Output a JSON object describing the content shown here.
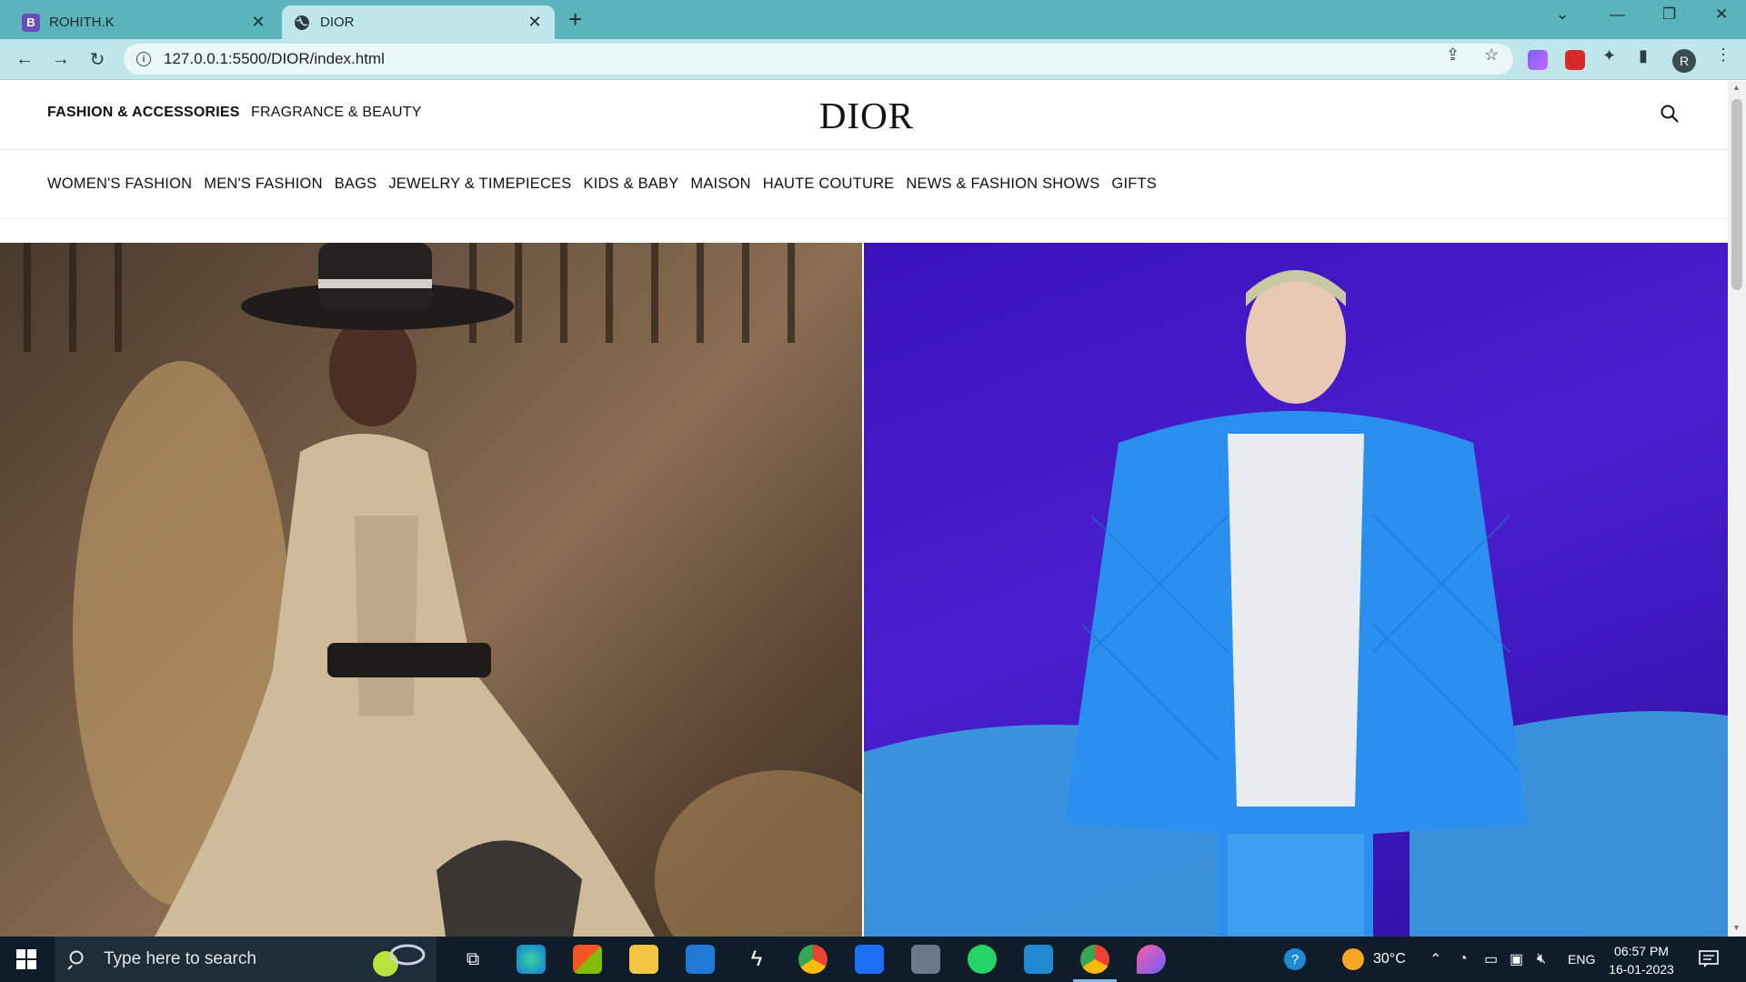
{
  "browser": {
    "tabs": [
      {
        "title": "ROHITH.K",
        "favicon": "B",
        "active": false
      },
      {
        "title": "DIOR",
        "favicon": "globe-icon",
        "active": true
      }
    ],
    "url": "127.0.0.1:5500/DIOR/index.html",
    "profile_initial": "R"
  },
  "site": {
    "top_nav": {
      "primary": "FASHION & ACCESSORIES",
      "secondary": "FRAGRANCE & BEAUTY"
    },
    "logo": "DIOR",
    "categories": [
      "WOMEN'S FASHION",
      "MEN'S FASHION",
      "BAGS",
      "JEWELRY & TIMEPIECES",
      "KIDS & BABY",
      "MAISON",
      "HAUTE COUTURE",
      "NEWS & FASHION SHOWS",
      "GIFTS"
    ],
    "hero": {
      "left_image": "woman-in-beige-dress-photo",
      "right_image": "man-in-blue-puffer-jacket-photo"
    }
  },
  "taskbar": {
    "search_placeholder": "Type here to search",
    "weather": "30°C",
    "language": "ENG",
    "time": "06:57 PM",
    "date": "16-01-2023"
  },
  "colors": {
    "tab_strip": "#5bb3bb",
    "toolbar": "#bfe6ea",
    "hero_right_bg": "#3a12b8",
    "taskbar": "#0f1d2a"
  }
}
